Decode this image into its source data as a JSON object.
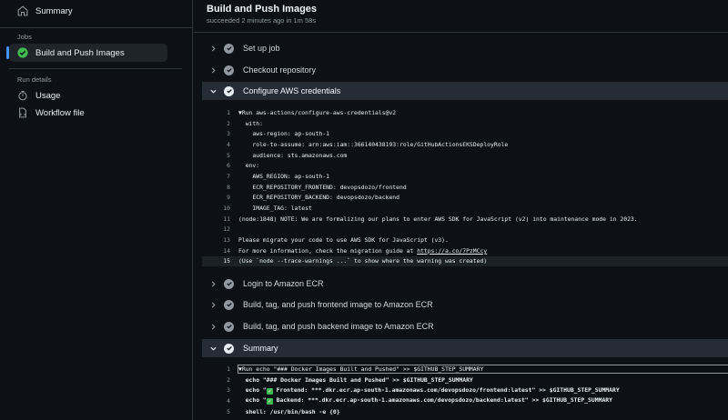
{
  "sidebar": {
    "summary_label": "Summary",
    "jobs_heading": "Jobs",
    "job_label": "Build and Push Images",
    "run_details_heading": "Run details",
    "usage_label": "Usage",
    "workflow_file_label": "Workflow file"
  },
  "header": {
    "title": "Build and Push Images",
    "subtitle": "succeeded 2 minutes ago in 1m 58s"
  },
  "steps": {
    "setup": "Set up job",
    "checkout": "Checkout repository",
    "aws": "Configure AWS credentials",
    "login": "Login to Amazon ECR",
    "frontend": "Build, tag, and push frontend image to Amazon ECR",
    "backend": "Build, tag, and push backend image to Amazon ECR",
    "summary": "Summary"
  },
  "aws_log": [
    {
      "n": "1",
      "t": "▼Run aws-actions/configure-aws-credentials@v2"
    },
    {
      "n": "2",
      "t": "  with:"
    },
    {
      "n": "3",
      "t": "    aws-region: ap-south-1"
    },
    {
      "n": "4",
      "t": "    role-to-assume: arn:aws:iam::366140438193:role/GitHubActionsEKSDeployRole"
    },
    {
      "n": "5",
      "t": "    audience: sts.amazonaws.com"
    },
    {
      "n": "6",
      "t": "  env:"
    },
    {
      "n": "7",
      "t": "    AWS_REGION: ap-south-1"
    },
    {
      "n": "8",
      "t": "    ECR_REPOSITORY_FRONTEND: devopsdozo/frontend"
    },
    {
      "n": "9",
      "t": "    ECR_REPOSITORY_BACKEND: devopsdozo/backend"
    },
    {
      "n": "10",
      "t": "    IMAGE_TAG: latest"
    },
    {
      "n": "11",
      "t": "(node:1848) NOTE: We are formalizing our plans to enter AWS SDK for JavaScript (v2) into maintenance mode in 2023."
    },
    {
      "n": "12",
      "t": ""
    },
    {
      "n": "13",
      "t": "Please migrate your code to use AWS SDK for JavaScript (v3)."
    },
    {
      "n": "14",
      "t": "For more information, check the migration guide at ",
      "link": "https://a.co/7PzMCcy"
    },
    {
      "n": "15",
      "t": "(Use `node --trace-warnings ...` to show where the warning was created)"
    }
  ],
  "summary_log": [
    {
      "n": "1",
      "t": "▼Run echo \"### Docker Images Built and Pushed\" >> $GITHUB_STEP_SUMMARY"
    },
    {
      "n": "2",
      "t": "  echo \"### Docker Images Built and Pushed\" >> $GITHUB_STEP_SUMMARY"
    },
    {
      "n": "3",
      "t": "  echo \"",
      "emoji": "✓",
      "t2": " Frontend: ***.dkr.ecr.ap-south-1.amazonaws.com/devopsdozo/frontend:latest\" >> $GITHUB_STEP_SUMMARY"
    },
    {
      "n": "4",
      "t": "  echo \"",
      "emoji": "✓",
      "t2": " Backend: ***.dkr.ecr.ap-south-1.amazonaws.com/devopsdozo/backend:latest\" >> $GITHUB_STEP_SUMMARY"
    },
    {
      "n": "5",
      "t": "  shell: /usr/bin/bash -e {0}"
    }
  ]
}
